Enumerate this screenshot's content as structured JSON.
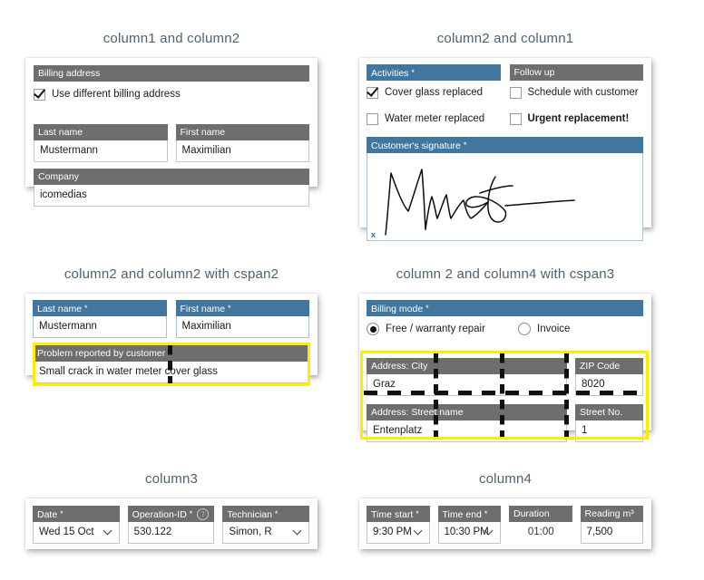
{
  "sections": [
    {
      "id": "s1",
      "title": "column1 and column2",
      "fields": {
        "billing_address_header": "Billing address",
        "use_different_billing_address": "Use different billing address",
        "last_name_header": "Last name",
        "last_name_value": "Mustermann",
        "first_name_header": "First name",
        "first_name_value": "Maximilian",
        "company_header": "Company",
        "company_value": "icomedias"
      }
    },
    {
      "id": "s2",
      "title": "column2 and column1",
      "fields": {
        "activities_header": "Activities",
        "activities_required": "*",
        "cover_glass_replaced": "Cover glass replaced",
        "water_meter_replaced": "Water meter replaced",
        "follow_up_header": "Follow up",
        "schedule_with_customer": "Schedule with customer",
        "urgent_replacement": "Urgent replacement!",
        "signature_header": "Customer's signature",
        "signature_required": "*",
        "signature_clear": "x"
      }
    },
    {
      "id": "s3",
      "title": "column2 and column2 with cspan2",
      "fields": {
        "last_name_header": "Last name",
        "last_name_required": "*",
        "last_name_value": "Mustermann",
        "first_name_header": "First name",
        "first_name_required": "*",
        "first_name_value": "Maximilian",
        "problem_header": "Problem reported by customer",
        "problem_value": "Small crack in water meter cover glass"
      }
    },
    {
      "id": "s4",
      "title": "column 2 and column4 with cspan3",
      "fields": {
        "billing_mode_header": "Billing mode",
        "billing_mode_required": "*",
        "option_free": "Free / warranty repair",
        "option_invoice": "Invoice",
        "city_header": "Address: City",
        "city_value": "Graz",
        "zip_header": "ZIP Code",
        "zip_value": "8020",
        "street_header": "Address: Street name",
        "street_value": "Entenplatz",
        "street_no_header": "Street No.",
        "street_no_value": "1"
      }
    },
    {
      "id": "s5",
      "title": "column3",
      "fields": {
        "date_header": "Date",
        "date_required": "*",
        "date_value": "Wed 15 Oct",
        "operation_id_header": "Operation-ID",
        "operation_id_required": "*",
        "operation_id_value": "530.122",
        "technician_header": "Technician",
        "technician_required": "*",
        "technician_value": "Simon, R"
      }
    },
    {
      "id": "s6",
      "title": "column4",
      "fields": {
        "time_start_header": "Time start",
        "time_start_required": "*",
        "time_start_value": "9:30 PM",
        "time_end_header": "Time end",
        "time_end_required": "*",
        "time_end_value": "10:30 PM",
        "duration_header": "Duration",
        "duration_value": "01:00",
        "reading_header": "Reading m³",
        "reading_required": "*",
        "reading_value": "7,500"
      }
    }
  ],
  "icons": {
    "help": "?",
    "chevron_down": "chevron-down-icon",
    "checkmark": "check-icon"
  },
  "colors": {
    "header_gray": "#6e6e6e",
    "header_blue": "#41769f",
    "title_text": "#4c6272",
    "highlight_yellow": "#ffed00",
    "field_border": "#c6c6c6",
    "field_border_blue": "#a9c3d6"
  }
}
